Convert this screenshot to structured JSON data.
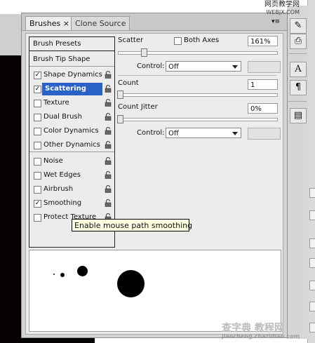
{
  "panel": {
    "tabs": [
      {
        "label": "Brushes ×"
      },
      {
        "label": "Clone Source"
      }
    ],
    "menu_glyph": "▾≡"
  },
  "brush_list": {
    "presets_label": "Brush Presets",
    "tip_shape_label": "Brush Tip Shape",
    "items": [
      {
        "label": "Shape Dynamics",
        "checked": true,
        "locked_icon": "lock-icon"
      },
      {
        "label": "Scattering",
        "checked": true,
        "selected": true,
        "locked_icon": "lock-icon"
      },
      {
        "label": "Texture",
        "checked": false,
        "locked_icon": "lock-icon"
      },
      {
        "label": "Dual Brush",
        "checked": false,
        "locked_icon": "lock-icon"
      },
      {
        "label": "Color Dynamics",
        "checked": false,
        "locked_icon": "lock-icon"
      },
      {
        "label": "Other Dynamics",
        "checked": false,
        "locked_icon": "lock-icon"
      },
      {
        "label": "Noise",
        "checked": false,
        "locked_icon": "lock-icon"
      },
      {
        "label": "Wet Edges",
        "checked": false,
        "locked_icon": "lock-icon"
      },
      {
        "label": "Airbrush",
        "checked": false,
        "locked_icon": "lock-icon"
      },
      {
        "label": "Smoothing",
        "checked": true,
        "locked_icon": "lock-icon"
      },
      {
        "label": "Protect Texture",
        "checked": false,
        "locked_icon": "lock-icon"
      }
    ]
  },
  "tooltip": "Enable mouse path smoothing",
  "controls": {
    "scatter_label": "Scatter",
    "both_axes_label": "Both Axes",
    "scatter_value": "161%",
    "control_label_1": "Control:",
    "control_select_1": "Off",
    "count_label": "Count",
    "count_value": "1",
    "count_jitter_label": "Count Jitter",
    "count_jitter_value": "0%",
    "control_label_2": "Control:",
    "control_select_2": "Off"
  },
  "watermark": {
    "top_line_1": "网页教学网",
    "top_line_2": "WEBJX.COM",
    "bottom_line_1": "查字典 教程网",
    "bottom_line_2": "jiaocheng.chazidian.com"
  },
  "colors": {
    "selection": "#2b62c8",
    "tooltip_bg": "#ffffe1",
    "panel_bg": "#ececec"
  }
}
